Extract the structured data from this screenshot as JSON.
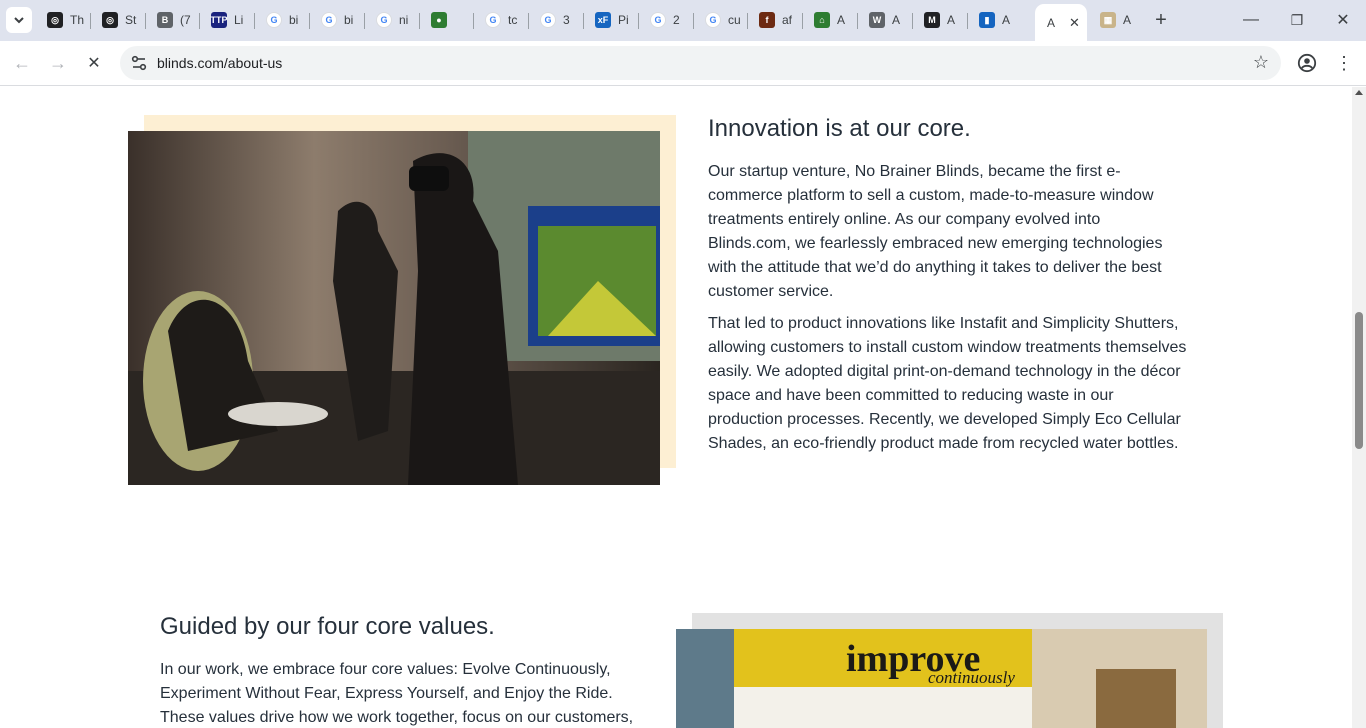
{
  "browser": {
    "tabs": [
      {
        "label": "Th",
        "fav_color": "#202124",
        "fav_glyph": "◎"
      },
      {
        "label": "St",
        "fav_color": "#202124",
        "fav_glyph": "◎"
      },
      {
        "label": "(7",
        "fav_color": "#5f6368",
        "fav_glyph": "B"
      },
      {
        "label": "Li",
        "fav_color": "#1a237e",
        "fav_glyph": "TTP"
      },
      {
        "label": "bi",
        "fav_color": "#4285f4",
        "fav_glyph": "G"
      },
      {
        "label": "bi",
        "fav_color": "#4285f4",
        "fav_glyph": "G"
      },
      {
        "label": "ni",
        "fav_color": "#4285f4",
        "fav_glyph": "G"
      },
      {
        "label": "",
        "fav_color": "#2e7d32",
        "fav_glyph": "●"
      },
      {
        "label": "tc",
        "fav_color": "#4285f4",
        "fav_glyph": "G"
      },
      {
        "label": "3",
        "fav_color": "#4285f4",
        "fav_glyph": "G"
      },
      {
        "label": "Pi",
        "fav_color": "#1565c0",
        "fav_glyph": "xF"
      },
      {
        "label": "2",
        "fav_color": "#4285f4",
        "fav_glyph": "G"
      },
      {
        "label": "cu",
        "fav_color": "#4285f4",
        "fav_glyph": "G"
      },
      {
        "label": "af",
        "fav_color": "#6d2a12",
        "fav_glyph": "f"
      },
      {
        "label": "A",
        "fav_color": "#2e7d32",
        "fav_glyph": "⌂"
      },
      {
        "label": "A",
        "fav_color": "#5f6368",
        "fav_glyph": "W"
      },
      {
        "label": "A",
        "fav_color": "#202124",
        "fav_glyph": "M"
      },
      {
        "label": "A",
        "fav_color": "#1565c0",
        "fav_glyph": "▮"
      }
    ],
    "active_tab": {
      "label": "A",
      "close_glyph": "✕"
    },
    "last_tab": {
      "label": "A",
      "fav_color": "#c9b48a",
      "fav_glyph": "▦"
    },
    "new_tab_glyph": "+",
    "window_controls": {
      "minimize": "—",
      "restore": "❐",
      "close": "✕"
    },
    "nav": {
      "back": "←",
      "forward": "→",
      "stop": "✕"
    },
    "url": "blinds.com/about-us",
    "star_glyph": "☆",
    "menu_glyph": "⋮"
  },
  "page": {
    "innovation": {
      "title": "Innovation is at our core.",
      "p1_lines": [
        "Our startup venture, No Brainer Blinds, became the first e-",
        "commerce platform to sell a custom, made-to-measure window",
        "treatments entirely online.  As our company evolved into",
        "Blinds.com, we fearlessly embraced new emerging technologies",
        "with the attitude that we’d do anything it takes to deliver the best",
        "customer service."
      ],
      "p2_lines": [
        "That led to product innovations like Instafit and Simplicity Shutters,",
        "allowing customers to install custom window treatments themselves",
        "easily. We adopted digital print-on-demand technology in the décor",
        "space and have been committed to reducing waste in our",
        "production processes. Recently, we developed Simply Eco Cellular",
        "Shades, an eco-friendly product made from recycled water bottles."
      ]
    },
    "values": {
      "title": "Guided by our four core values.",
      "lines": [
        "In our work, we embrace four core values: Evolve Continuously,",
        "Experiment Without Fear, Express Yourself, and Enjoy the Ride.",
        "These values drive how we work together, focus on our customers,"
      ],
      "sign_word": "improve",
      "sign_sub": "continuously"
    }
  }
}
